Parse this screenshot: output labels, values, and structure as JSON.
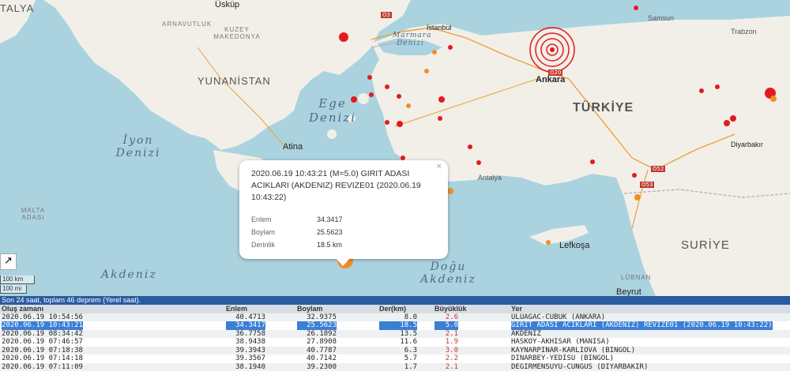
{
  "map": {
    "countries": [
      "TALYA",
      "YUNANİSTAN",
      "TÜRKİYE",
      "SURİYE",
      "KUZEY MAKEDONYA",
      "ARNAVUTLUK",
      "MALTA ADASI"
    ],
    "seas": [
      "İyon Denizi",
      "Ege Denizi",
      "Akdeniz",
      "Doğu Akdeniz",
      "Marmara Denizi"
    ],
    "cities": [
      "Üsküp",
      "İstanbul",
      "Samsun",
      "Trabzon",
      "Ankara",
      "Atina",
      "Antalya",
      "Lefkoşa",
      "Diyarbakır",
      "Beyrut",
      "LÜBNAN"
    ],
    "roads": [
      "O3",
      "O20",
      "O52",
      "O53"
    ],
    "scale": {
      "km": "100 km",
      "mi": "100 mi"
    },
    "colors": {
      "sea": "#aad3df",
      "land": "#f2efe9",
      "road": "#e8a33a",
      "quake_recent": "#e31a1c",
      "quake_old": "#f28c28",
      "selected": "#f28c28"
    }
  },
  "popup": {
    "title": "2020.06.19 10:43:21 (M=5.0) GIRIT ADASI ACIKLARI (AKDENIZ) REVIZE01 (2020.06.19 10:43:22)",
    "close": "×",
    "lat_label": "Enlem",
    "lat": "34.3417",
    "lon_label": "Boylam",
    "lon": "25.5623",
    "depth_label": "Derinlik",
    "depth": "18.5 km"
  },
  "table": {
    "status": "Son 24 saat, toplam 46 deprem (Yerel saat).",
    "headers": [
      "Oluş zamanı",
      "Enlem",
      "Boylam",
      "Der(km)",
      "Büyüklük",
      "Yer"
    ],
    "rows": [
      [
        "2020.06.19 10:54:56",
        "40.4713",
        "32.9375",
        "8.0",
        "2.6",
        "ULUAGAC-CUBUK (ANKARA)"
      ],
      [
        "2020.06.19 10:43:21",
        "34.3417",
        "25.5623",
        "18.5",
        "5.0",
        "GIRIT ADASI ACIKLARI (AKDENIZ) REVIZE01 (2020.06.19 10:43:22)"
      ],
      [
        "2020.06.19 08:34:42",
        "36.7758",
        "26.1892",
        "13.5",
        "2.1",
        "AKDENIZ"
      ],
      [
        "2020.06.19 07:46:57",
        "38.9438",
        "27.8908",
        "11.6",
        "1.9",
        "HASKOY-AKHISAR (MANISA)"
      ],
      [
        "2020.06.19 07:18:38",
        "39.3943",
        "40.7787",
        "6.3",
        "3.0",
        "KAYNARPINAR-KARLIOVA (BINGOL)"
      ],
      [
        "2020.06.19 07:14:18",
        "39.3567",
        "40.7142",
        "5.7",
        "2.2",
        "DINARBEY-YEDISU (BINGOL)"
      ],
      [
        "2020.06.19 07:11:09",
        "38.1940",
        "39.2300",
        "1.7",
        "2.1",
        "DEGIRMENSUYU-CUNGUS (DIYARBAKIR)"
      ]
    ]
  }
}
